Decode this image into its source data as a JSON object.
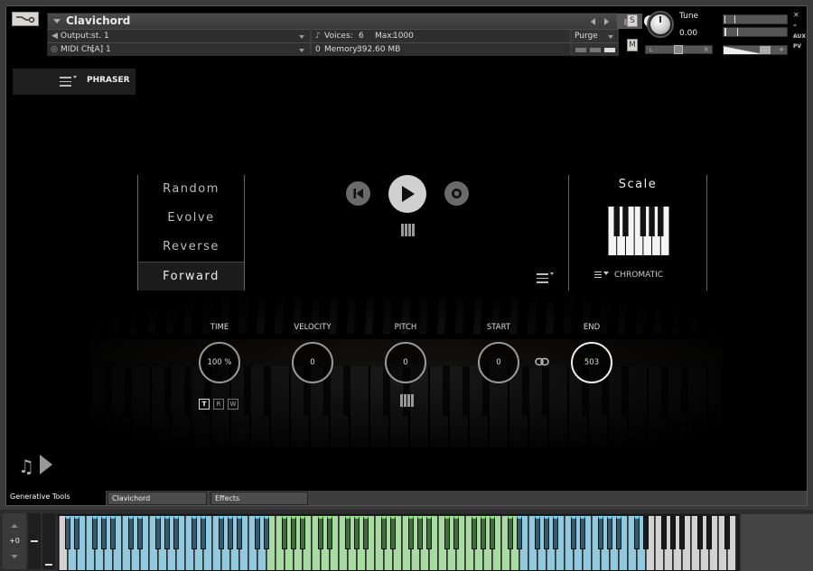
{
  "header": {
    "instrument_name": "Clavichord",
    "output_label": "Output:",
    "output_value": "st. 1",
    "midi_label": "MIDI Ch:",
    "midi_value": "[A]  1",
    "voices_label": "Voices:",
    "voices_value": "6",
    "max_label": "Max:",
    "max_value": "1000",
    "memory_label": "Memory:",
    "memory_value": "392.60 MB",
    "memory_prefix": "0",
    "purge_label": "Purge",
    "info_label": "i",
    "solo_label": "S",
    "mute_label": "M",
    "tune_label": "Tune",
    "tune_value": "0.00",
    "pan_left": "L",
    "pan_right": "R",
    "vol_minus": "–",
    "vol_plus": "+",
    "close_label": "✕",
    "minimize_label": "–",
    "aux_label": "AUX",
    "pv_label": "PV"
  },
  "phraser": {
    "label": "PHRASER"
  },
  "modes": {
    "items": [
      "Random",
      "Evolve",
      "Reverse",
      "Forward"
    ],
    "selected": "Forward"
  },
  "scale": {
    "title": "Scale",
    "selected": "CHROMATIC"
  },
  "knobs": {
    "time": {
      "label": "TIME",
      "value": "100 %"
    },
    "velocity": {
      "label": "VELOCITY",
      "value": "0"
    },
    "pitch": {
      "label": "PITCH",
      "value": "0"
    },
    "start": {
      "label": "START",
      "value": "0"
    },
    "end": {
      "label": "END",
      "value": "503"
    }
  },
  "trw": {
    "t": "T",
    "r": "R",
    "w": "W",
    "active": "T"
  },
  "tabs": {
    "active": "Generative Tools",
    "t2": "Clavichord",
    "t3": "Effects"
  },
  "octave": {
    "value": "+0"
  },
  "keyboard": {
    "total_keys": 128,
    "first_note": "C-2",
    "colors": {
      "blue": "#8ecae0",
      "blue_black": "#2f5c6e",
      "green": "#a7dca0",
      "green_black": "#3c6e35",
      "white": "#d2d2d2",
      "black": "#1a1a1a"
    },
    "zones": [
      {
        "from": 1,
        "to": 39,
        "color": "blue"
      },
      {
        "from": 40,
        "to": 86,
        "color": "green"
      },
      {
        "from": 87,
        "to": 110,
        "color": "blue"
      }
    ]
  },
  "colors": {
    "accent": "#d0d0d0",
    "panel": "#3c3c3c"
  }
}
